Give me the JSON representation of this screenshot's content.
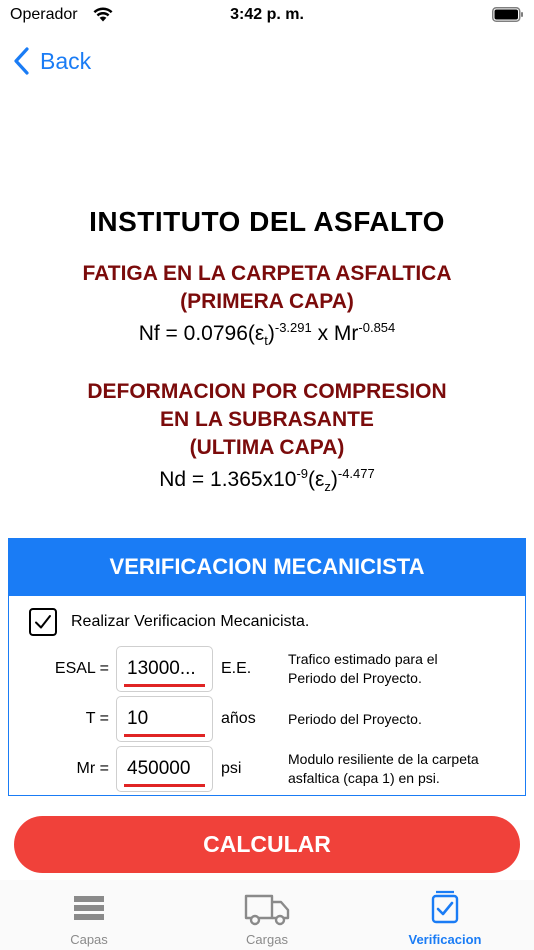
{
  "status_bar": {
    "carrier": "Operador",
    "time": "3:42 p. m."
  },
  "nav": {
    "back_label": "Back"
  },
  "header": {
    "title": "INSTITUTO DEL ASFALTO",
    "fatigue_title_line1": "FATIGA EN LA CARPETA ASFALTICA",
    "fatigue_title_line2": "(PRIMERA CAPA)",
    "fatigue_formula": {
      "lhs": "Nf = 0.0796(ε",
      "sub": "t",
      "paren_close": ")",
      "exp1": "-3.291",
      "mid": " x Mr",
      "exp2": "-0.854"
    },
    "deformation_title_line1": "DEFORMACION POR COMPRESION",
    "deformation_title_line2": "EN LA SUBRASANTE",
    "deformation_title_line3": "(ULTIMA CAPA)",
    "deformation_formula": {
      "lhs": "Nd = 1.365x10",
      "exp_pow": "-9",
      "paren_open": "(ε",
      "sub": "z",
      "paren_close": ")",
      "exp1": "-4.477"
    }
  },
  "panel": {
    "title": "VERIFICACION MECANICISTA",
    "checkbox_label": "Realizar Verificacion Mecanicista.",
    "checkbox_checked": true,
    "fields": [
      {
        "label": "ESAL =",
        "value": "13000...",
        "unit": "E.E.",
        "desc_line1": "Trafico estimado para el",
        "desc_line2": "Periodo del Proyecto."
      },
      {
        "label": "T =",
        "value": "10",
        "unit": "años",
        "desc_line1": "Periodo del Proyecto.",
        "desc_line2": ""
      },
      {
        "label": "Mr =",
        "value": "450000",
        "unit": "psi",
        "desc_line1": "Modulo resiliente de la carpeta",
        "desc_line2": "asfaltica (capa 1) en psi."
      }
    ]
  },
  "calc_button_label": "CALCULAR",
  "tabs": [
    {
      "label": "Capas",
      "icon": "layers-icon",
      "active": false
    },
    {
      "label": "Cargas",
      "icon": "truck-icon",
      "active": false
    },
    {
      "label": "Verificacion",
      "icon": "checklist-icon",
      "active": true
    }
  ],
  "colors": {
    "accent": "#1a7cf5",
    "section_title": "#7b0b0b",
    "calc_button": "#f0413a",
    "input_underline": "#e02424",
    "tab_inactive": "#8a8a8a"
  }
}
